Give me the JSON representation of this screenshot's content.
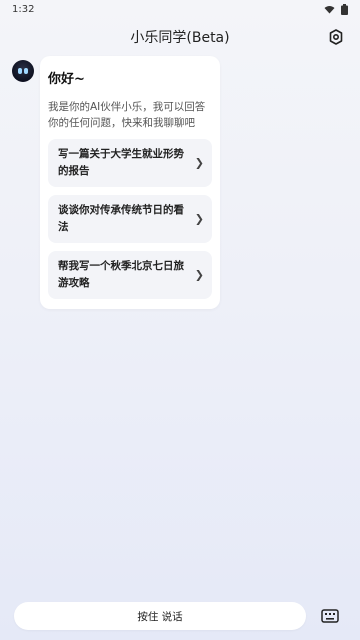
{
  "status": {
    "time": "1:32"
  },
  "header": {
    "title": "小乐同学(Beta)"
  },
  "chat": {
    "greeting": "你好~",
    "intro": "我是你的AI伙伴小乐，我可以回答你的任何问题，快来和我聊聊吧",
    "suggestions": [
      {
        "label": "写一篇关于大学生就业形势的报告"
      },
      {
        "label": "谈谈你对传承传统节日的看法"
      },
      {
        "label": "帮我写一个秋季北京七日旅游攻略"
      }
    ]
  },
  "footer": {
    "talk_label": "按住 说话"
  },
  "icons": {
    "settings": "settings-icon",
    "keyboard": "keyboard-icon",
    "wifi": "wifi-icon",
    "battery": "battery-icon",
    "chevron": "chevron-right-icon"
  },
  "colors": {
    "accent": "#1a1a1a",
    "background_top": "#f4f5f9",
    "background_bottom": "#e5e9f7"
  }
}
